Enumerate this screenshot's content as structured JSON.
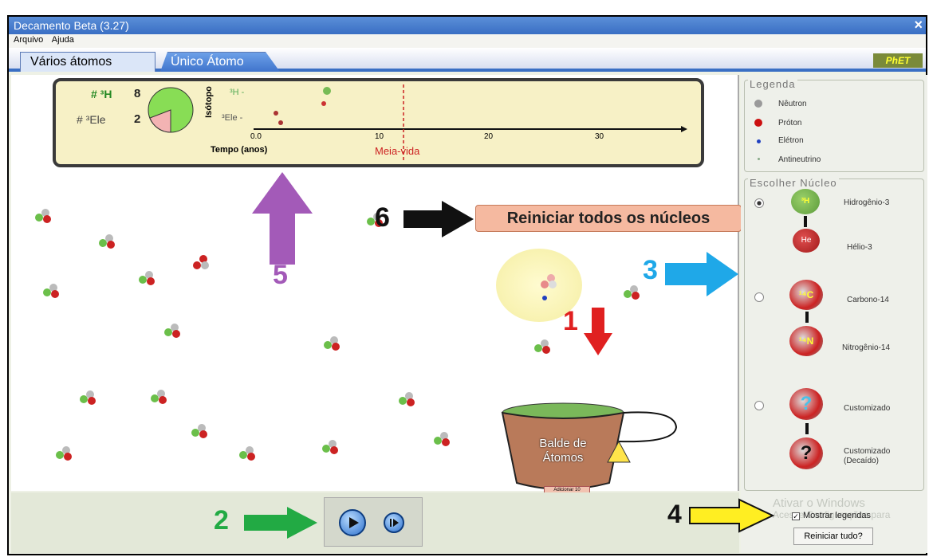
{
  "window": {
    "title": "Decamento Beta (3.27)",
    "close": "×"
  },
  "menu": {
    "items": [
      "Arquivo",
      "Ajuda"
    ]
  },
  "tabs": [
    {
      "label": "Vários átomos",
      "active": true
    },
    {
      "label": "Único Átomo",
      "active": false
    }
  ],
  "brand": "PhET",
  "chart": {
    "h3_label": "# ³H",
    "h3_count": "8",
    "he3_label": "# ³Ele",
    "he3_count": "2",
    "isotope_axis": "Isótopo",
    "row_h3": "³H -",
    "row_he3": "³Ele -",
    "xlabel": "Tempo (anos)",
    "ticks": [
      "0.0",
      "10",
      "20",
      "30"
    ],
    "halflife_label": "Meia-vida"
  },
  "legend": {
    "title": "Legenda",
    "items": [
      {
        "label": "Nêutron",
        "color": "#9a9a9a"
      },
      {
        "label": "Próton",
        "color": "#cc1010"
      },
      {
        "label": "Elétron",
        "color": "#2040c0"
      },
      {
        "label": "Antineutrino",
        "color": "#88aa88"
      }
    ]
  },
  "nucleus": {
    "title": "Escolher Núcleo",
    "options": [
      {
        "label": "Hidrogênio-3",
        "decay": "Hélio-3",
        "symbol": "³H",
        "decay_symbol": "He",
        "selected": true
      },
      {
        "label": "Carbono-14",
        "decay": "Nitrogênio-14",
        "symbol": "¹⁴C",
        "decay_symbol": "¹⁴N",
        "selected": false
      },
      {
        "label": "Customizado",
        "decay": "Customizado (Decaído)",
        "symbol": "?",
        "decay_symbol": "?",
        "selected": false
      }
    ]
  },
  "reset_all_nuclei": "Reiniciar todos os núcleos",
  "bucket": {
    "label_line1": "Balde de",
    "label_line2": "Átomos",
    "add_button": "Adicionar 10"
  },
  "show_labels": {
    "label": "Mostrar legendas",
    "checked": true
  },
  "reset_all": "Reiniciar tudo?",
  "watermark": {
    "line1": "Ativar o Windows",
    "line2": "Acesse Configurações para"
  },
  "annotations": {
    "n1": "1",
    "n2": "2",
    "n3": "3",
    "n4": "4",
    "n5": "5",
    "n6": "6"
  },
  "colors": {
    "arrow_red": "#e02020",
    "arrow_green": "#22aa44",
    "arrow_blue": "#1fa8e8",
    "arrow_yellow": "#ffee22",
    "arrow_purple": "#a35ab8",
    "arrow_black": "#111111"
  }
}
